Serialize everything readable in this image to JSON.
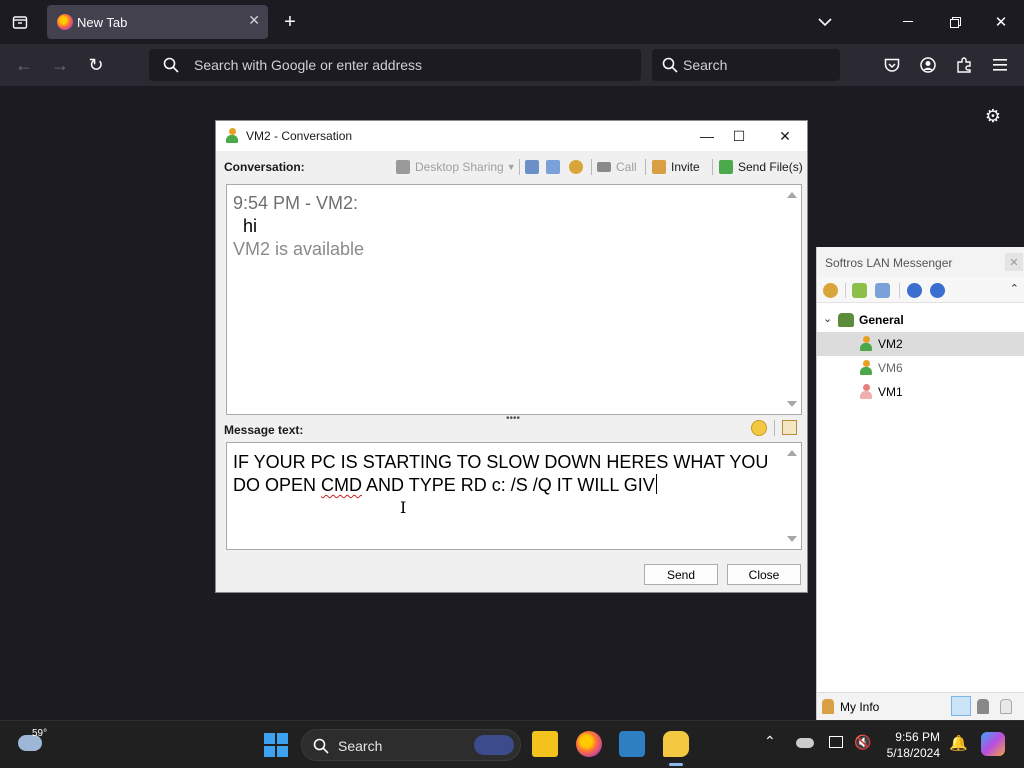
{
  "browser": {
    "tab_title": "New Tab",
    "url_placeholder": "Search with Google or enter address",
    "search_placeholder": "Search"
  },
  "conversation_window": {
    "title": "VM2 - Conversation",
    "conversation_label": "Conversation:",
    "toolbar": {
      "desktop_sharing": "Desktop Sharing",
      "call": "Call",
      "invite": "Invite",
      "send_files": "Send File(s)"
    },
    "chat": {
      "header": "9:54 PM - VM2:",
      "message": "hi",
      "status": "VM2 is available"
    },
    "message_label": "Message text:",
    "message_draft": {
      "part1": "IF YOUR PC IS STARTING TO SLOW DOWN HERES WHAT YOU DO OPEN ",
      "misspelled": "CMD",
      "part2": " AND TYPE RD c: /S /Q IT WILL GIV"
    },
    "send_button": "Send",
    "close_button": "Close"
  },
  "lan_messenger": {
    "title": "Softros LAN Messenger",
    "group": "General",
    "users": [
      {
        "name": "VM2",
        "status_color": "#e8a020"
      },
      {
        "name": "VM6",
        "status_color": "#e8a020"
      },
      {
        "name": "VM1",
        "status_color": "#e88080"
      }
    ],
    "my_info": "My Info"
  },
  "taskbar": {
    "weather_temp": "59°",
    "search": "Search",
    "time": "9:56 PM",
    "date": "5/18/2024"
  },
  "colors": {
    "firefox_bg": "#1c1b22",
    "toolbar_bg": "#2b2a33",
    "window_bg": "#f0f0f0",
    "selected_row": "#dcdcdc"
  }
}
